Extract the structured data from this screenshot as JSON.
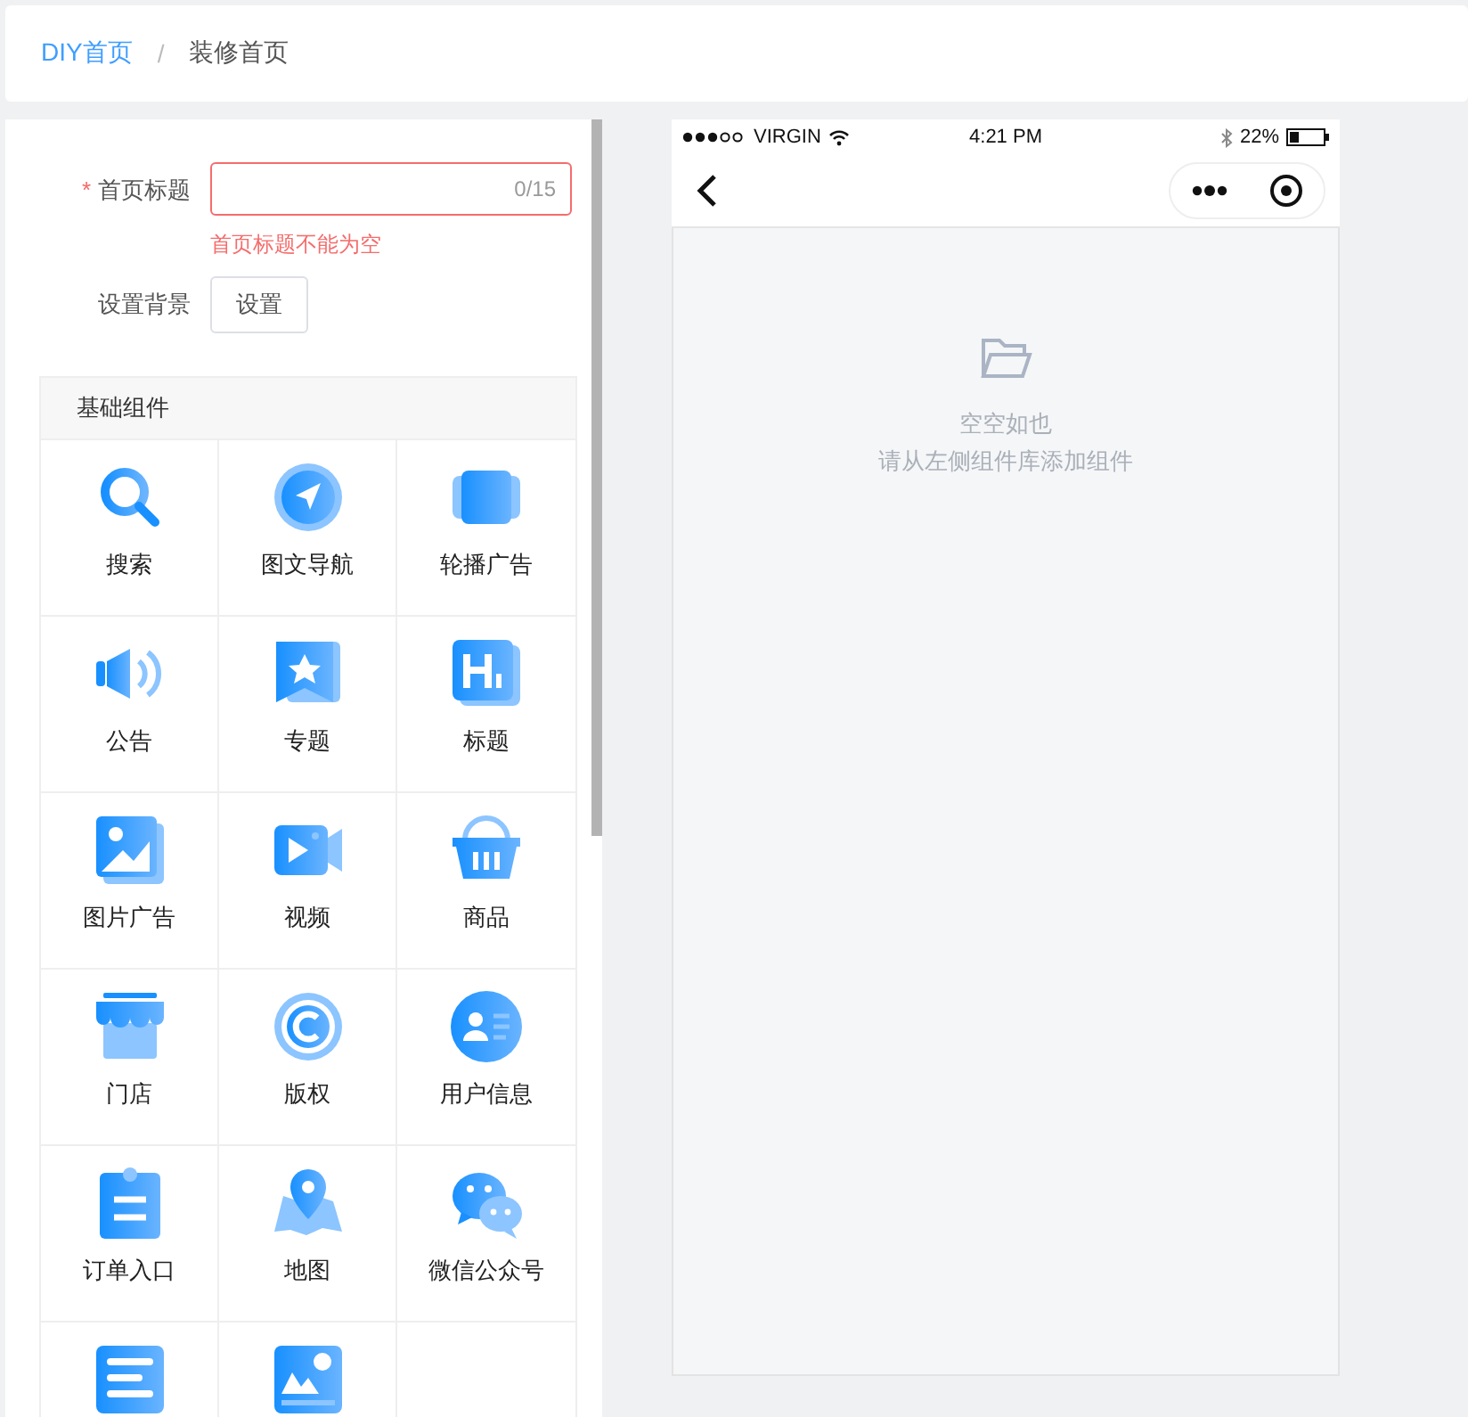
{
  "breadcrumb": {
    "separator": "/",
    "items": [
      {
        "label": "DIY首页",
        "link": true
      },
      {
        "label": "装修首页",
        "link": false
      }
    ]
  },
  "form": {
    "title_field": {
      "required_mark": "*",
      "label": "首页标题",
      "count": "0/15",
      "error": "首页标题不能为空"
    },
    "background": {
      "label": "设置背景",
      "button": "设置"
    }
  },
  "components": {
    "title": "基础组件",
    "items": [
      {
        "kind": "search",
        "label": "搜索"
      },
      {
        "kind": "nav",
        "label": "图文导航"
      },
      {
        "kind": "carousel",
        "label": "轮播广告"
      },
      {
        "kind": "notice",
        "label": "公告"
      },
      {
        "kind": "topic",
        "label": "专题"
      },
      {
        "kind": "heading",
        "label": "标题"
      },
      {
        "kind": "image",
        "label": "图片广告"
      },
      {
        "kind": "video",
        "label": "视频"
      },
      {
        "kind": "goods",
        "label": "商品"
      },
      {
        "kind": "store",
        "label": "门店"
      },
      {
        "kind": "copyright",
        "label": "版权"
      },
      {
        "kind": "user",
        "label": "用户信息"
      },
      {
        "kind": "order",
        "label": "订单入口"
      },
      {
        "kind": "map",
        "label": "地图"
      },
      {
        "kind": "wechat",
        "label": "微信公众号"
      },
      {
        "kind": "article"
      },
      {
        "kind": "gallery"
      }
    ]
  },
  "phone": {
    "status_bar": {
      "carrier": "VIRGIN",
      "time": "4:21 PM",
      "battery": "22%"
    },
    "empty": {
      "title": "空空如也",
      "hint": "请从左侧组件库添加组件"
    }
  }
}
